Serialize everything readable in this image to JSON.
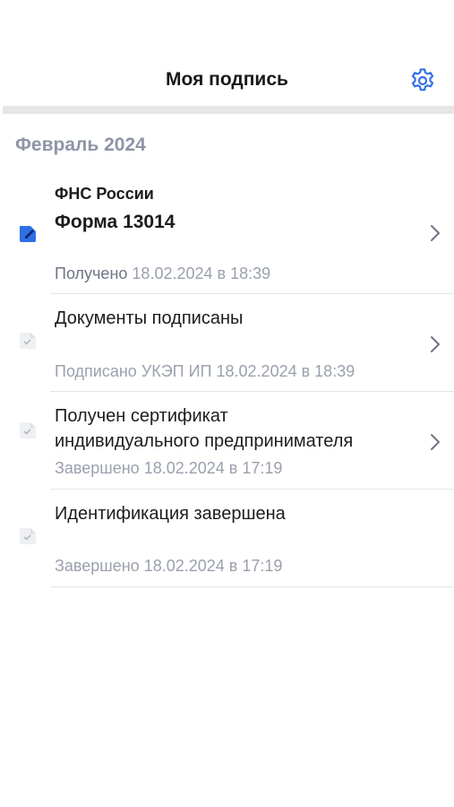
{
  "header": {
    "title": "Моя подпись",
    "settings_icon": "gear-icon"
  },
  "section": {
    "title": "Февраль 2024"
  },
  "items": [
    {
      "sender": "ФНС России",
      "title": "Форма 13014",
      "status_label": "Получено",
      "status_date": "18.02.2024 в 18:39",
      "icon": "document-edit-icon",
      "has_chevron": true
    },
    {
      "title": "Документы подписаны",
      "status_label": "Подписано УКЭП ИП",
      "status_date": "18.02.2024 в 18:39",
      "icon": "document-check-icon",
      "has_chevron": true
    },
    {
      "title_line1": "Получен сертификат",
      "title_line2": "индивидуального предпринимателя",
      "status_label": "Завершено",
      "status_date": "18.02.2024 в 17:19",
      "icon": "document-check-icon",
      "has_chevron": true
    },
    {
      "title": "Идентификация завершена",
      "status_label": "Завершено",
      "status_date": "18.02.2024 в 17:19",
      "icon": "document-check-icon",
      "has_chevron": false
    }
  ],
  "colors": {
    "accent": "#2f6fe4",
    "muted": "#9aa0ad",
    "section": "#8e95a6"
  }
}
